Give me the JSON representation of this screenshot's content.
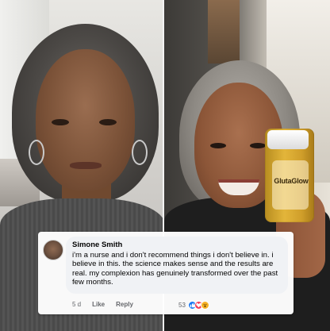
{
  "comment": {
    "author": "Simone Smith",
    "text": "i'm a nurse and i don't recommend things i don't believe in. i believe in this. the science makes sense and the results are real. my complexion has genuinely transformed over the past few months.",
    "time": "5 d",
    "like_label": "Like",
    "reply_label": "Reply",
    "reaction_count": "53",
    "reactions": [
      "like-icon",
      "love-icon",
      "wow-icon"
    ]
  },
  "product": {
    "brand": "GlutaGlow"
  },
  "colors": {
    "like": "#1877f2",
    "love": "#f33e58",
    "wow": "#f7b125",
    "bubble": "#f0f2f5"
  }
}
